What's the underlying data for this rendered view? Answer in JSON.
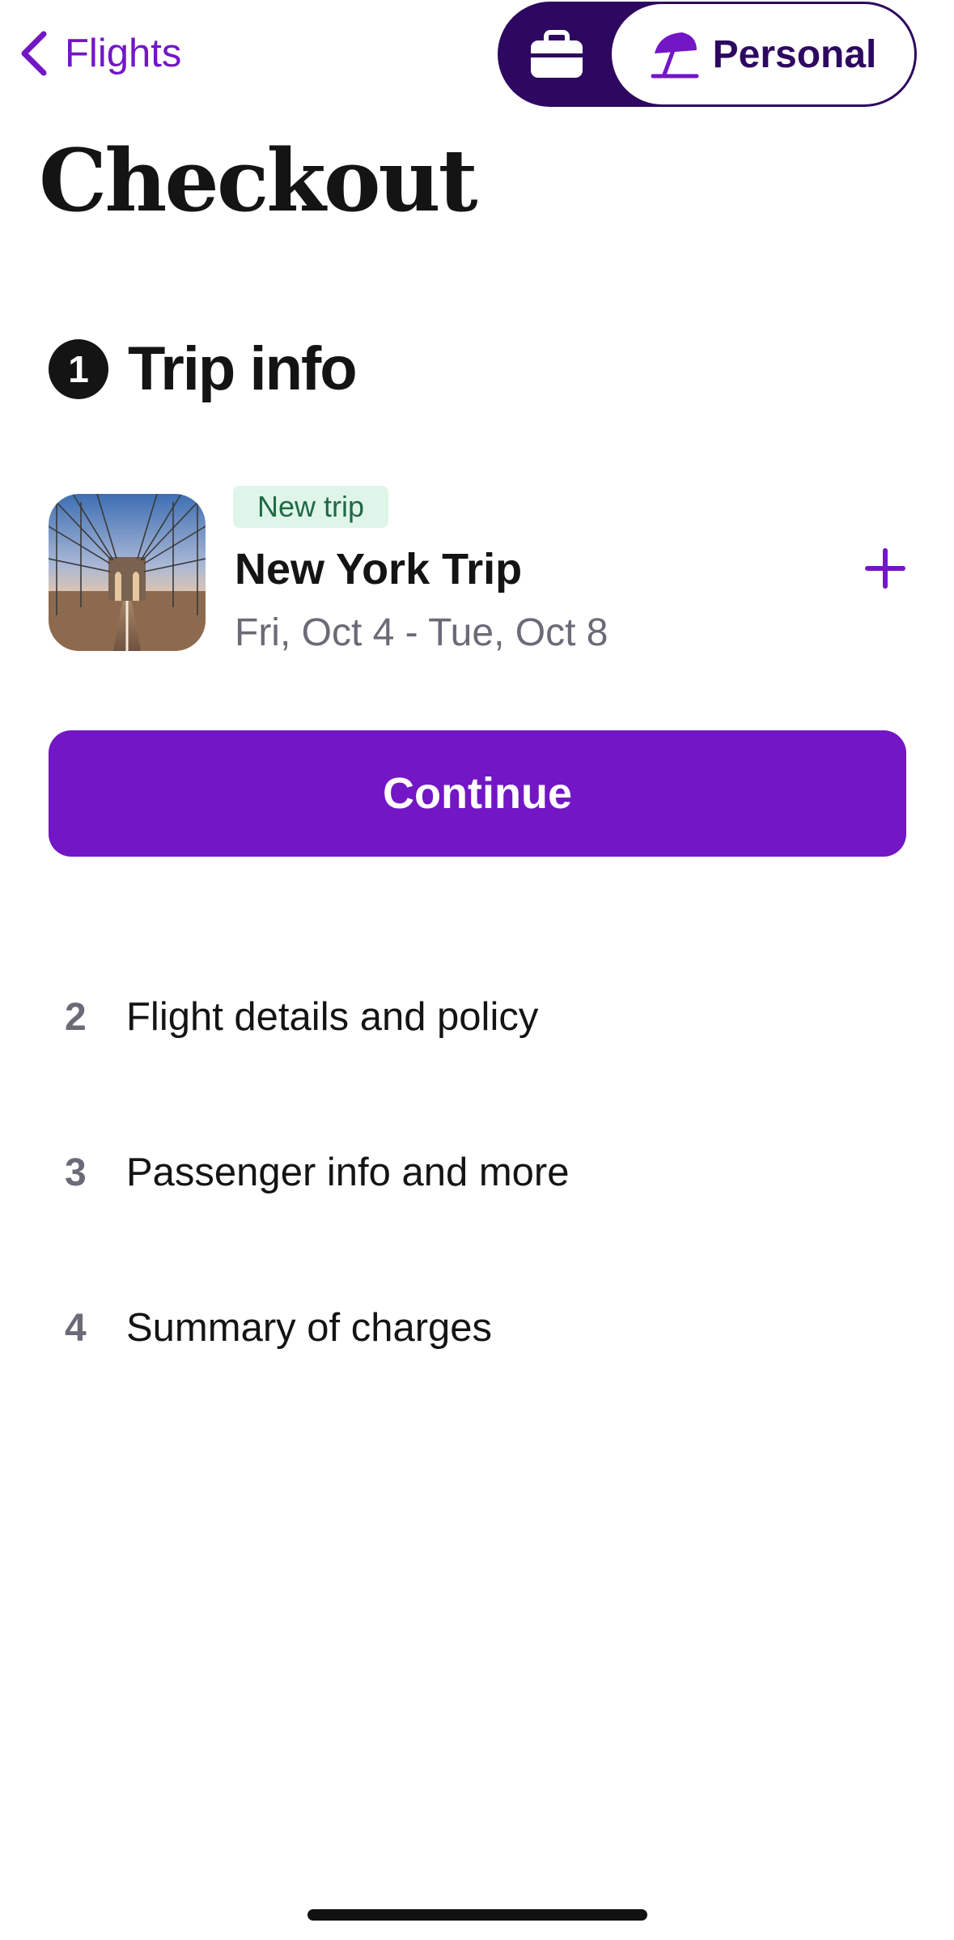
{
  "nav": {
    "back_label": "Flights"
  },
  "mode_toggle": {
    "work_icon": "briefcase-icon",
    "personal_icon": "beach-umbrella-icon",
    "personal_label": "Personal",
    "selected": "Personal"
  },
  "page": {
    "title": "Checkout"
  },
  "trip_info": {
    "step_number": "1",
    "title": "Trip info",
    "trip": {
      "badge": "New trip",
      "name": "New York Trip",
      "dates": "Fri, Oct 4 - Tue, Oct 8",
      "thumbnail": "bridge-photo"
    },
    "add_icon": "plus-icon"
  },
  "actions": {
    "continue_label": "Continue"
  },
  "steps": [
    {
      "number": "2",
      "label": "Flight details and policy"
    },
    {
      "number": "3",
      "label": "Passenger info and more"
    },
    {
      "number": "4",
      "label": "Summary of charges"
    }
  ],
  "colors": {
    "accent": "#7316c6",
    "toggle_bg": "#2e0860",
    "badge_bg": "#dff5ea",
    "badge_text": "#1f6a44",
    "muted_text": "#6b6b78"
  }
}
